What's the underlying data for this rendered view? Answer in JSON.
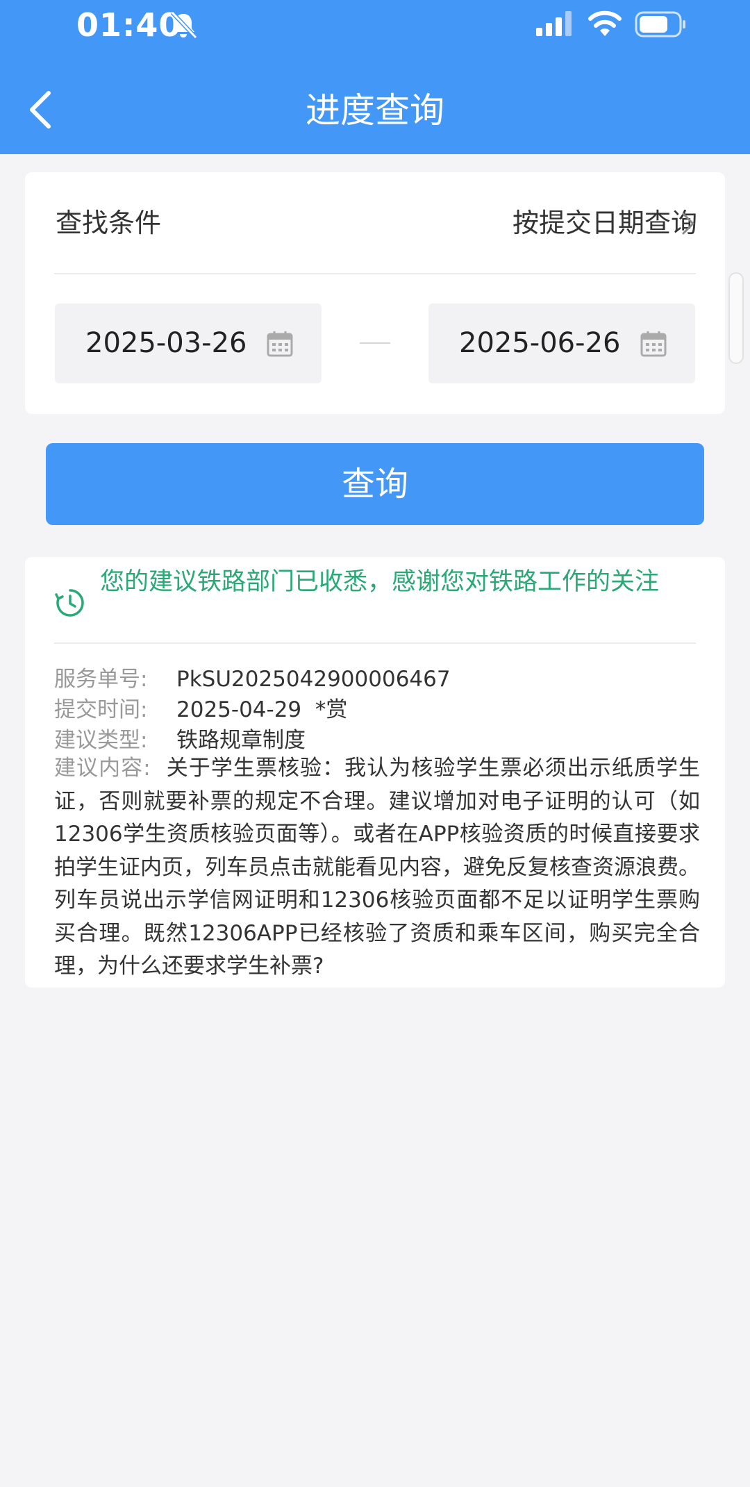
{
  "status_bar": {
    "time": "01:40",
    "icons": [
      "bell-off-icon",
      "signal-icon",
      "wifi-icon",
      "battery-icon"
    ]
  },
  "nav": {
    "back_icon": "chevron-left-icon",
    "title": "进度查询"
  },
  "filter": {
    "label": "查找条件",
    "option": "按提交日期查询",
    "start_date": "2025-03-26",
    "end_date": "2025-06-26"
  },
  "query_button": {
    "label": "查询"
  },
  "result": {
    "status_message": "您的建议铁路部门已收悉，感谢您对铁路工作的关注",
    "service_no_label": "服务单号:",
    "service_no": "PkSU2025042900006467",
    "submit_time_label": "提交时间:",
    "submit_time": "2025-04-29  *赏",
    "type_label": "建议类型:",
    "type": "铁路规章制度",
    "content_label": "建议内容:",
    "content": "关于学生票核验：我认为核验学生票必须出示纸质学生证，否则就要补票的规定不合理。建议增加对电子证明的认可（如12306学生资质核验页面等）。或者在APP核验资质的时候直接要求拍学生证内页，列车员点击就能看见内容，避免反复核查资源浪费。列车员说出示学信网证明和12306核验页面都不足以证明学生票购买合理。既然12306APP已经核验了资质和乘车区间，购买完全合理，为什么还要求学生补票?"
  },
  "colors": {
    "header": "#4398f7",
    "button": "#4398f7",
    "status_text": "#2aa876",
    "page_background": "#f4f4f6"
  }
}
